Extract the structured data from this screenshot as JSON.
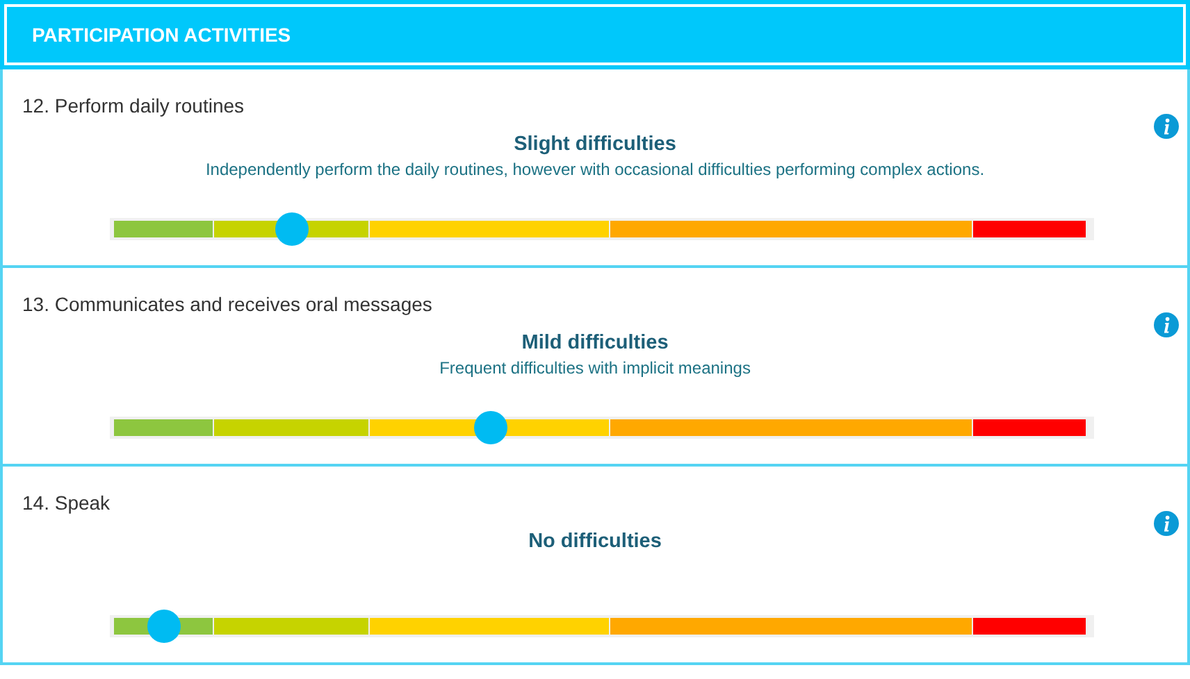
{
  "header": {
    "title": "PARTICIPATION ACTIVITIES"
  },
  "items": [
    {
      "title": "12. Perform daily routines",
      "rating": "Slight difficulties",
      "description": "Independently perform the daily routines, however with occasional difficulties performing complex actions.",
      "level": 0.183
    },
    {
      "title": "13. Communicates and receives oral messages",
      "rating": "Mild difficulties",
      "description": "Frequent difficulties with implicit meanings",
      "level": 0.387
    },
    {
      "title": "14. Speak",
      "rating": "No difficulties",
      "level": 0.051
    }
  ]
}
